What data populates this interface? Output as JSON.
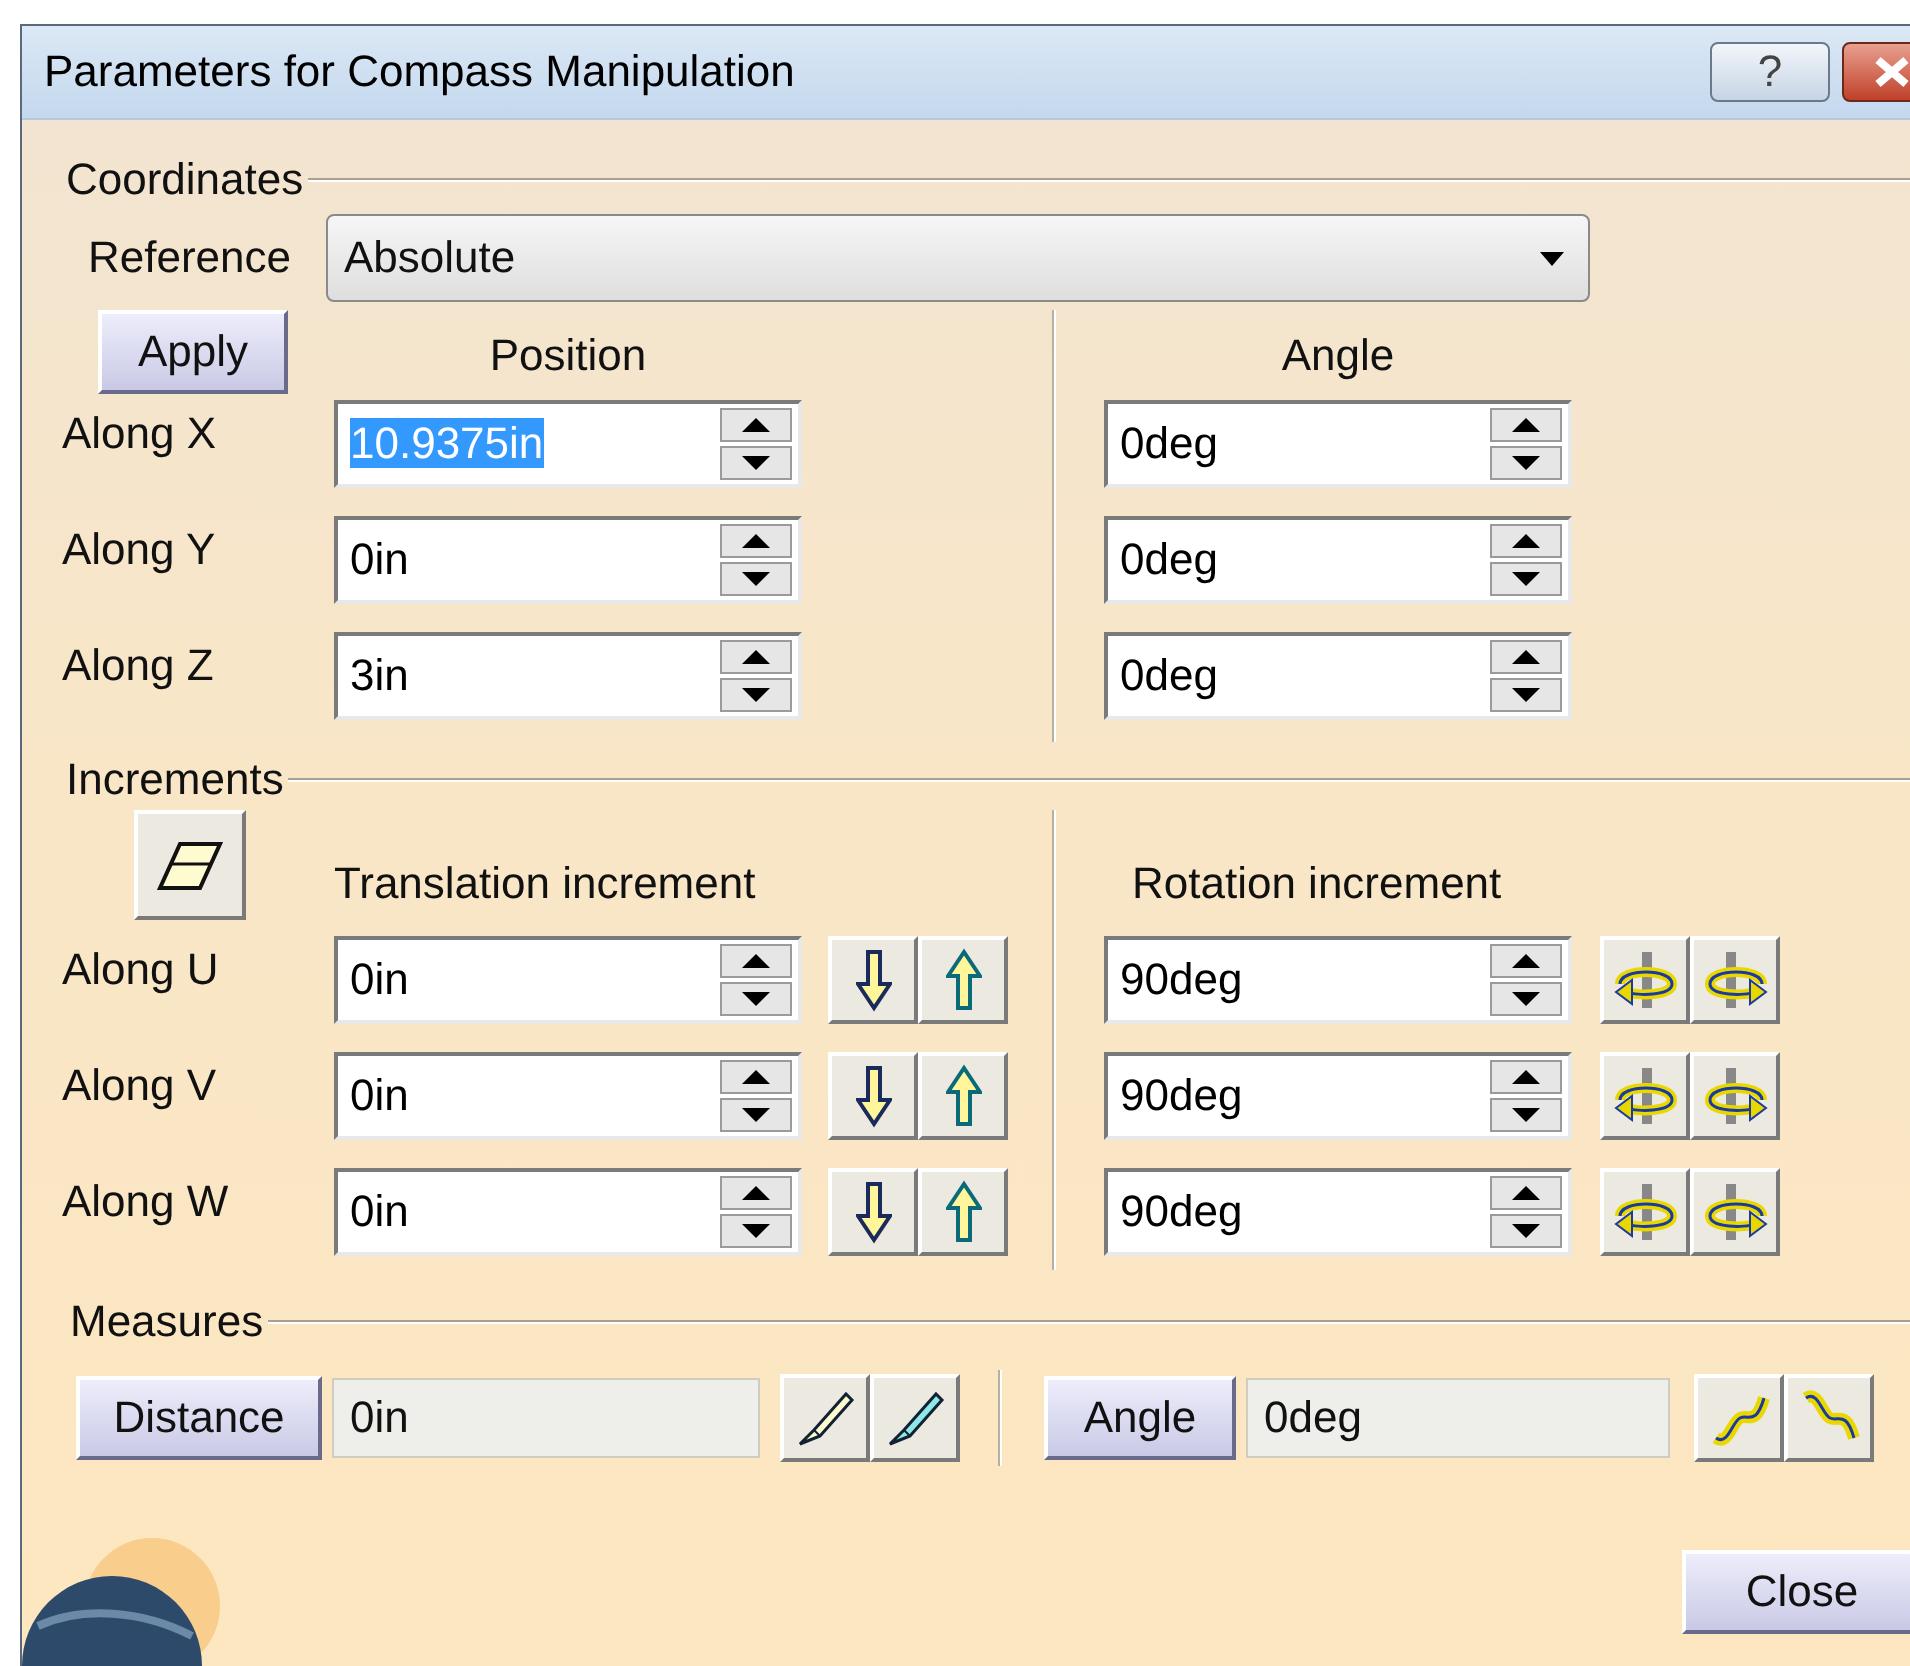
{
  "window": {
    "title": "Parameters for Compass Manipulation",
    "help_button": "?"
  },
  "coordinates": {
    "heading": "Coordinates",
    "reference_label": "Reference",
    "reference_value": "Absolute",
    "apply_button": "Apply",
    "position_heading": "Position",
    "angle_heading": "Angle",
    "rows": [
      {
        "label": "Along X",
        "position": "10.9375in",
        "position_text_selected": true,
        "angle": "0deg"
      },
      {
        "label": "Along Y",
        "position": "0in",
        "position_text_selected": false,
        "angle": "0deg"
      },
      {
        "label": "Along Z",
        "position": "3in",
        "position_text_selected": false,
        "angle": "0deg"
      }
    ]
  },
  "increments": {
    "heading": "Increments",
    "translation_heading": "Translation increment",
    "rotation_heading": "Rotation increment",
    "rows": [
      {
        "label": "Along U",
        "translation": "0in",
        "rotation": "90deg"
      },
      {
        "label": "Along V",
        "translation": "0in",
        "rotation": "90deg"
      },
      {
        "label": "Along W",
        "translation": "0in",
        "rotation": "90deg"
      }
    ]
  },
  "measures": {
    "heading": "Measures",
    "distance_button": "Distance",
    "distance_value": "0in",
    "angle_button": "Angle",
    "angle_value": "0deg"
  },
  "close_button": "Close"
}
